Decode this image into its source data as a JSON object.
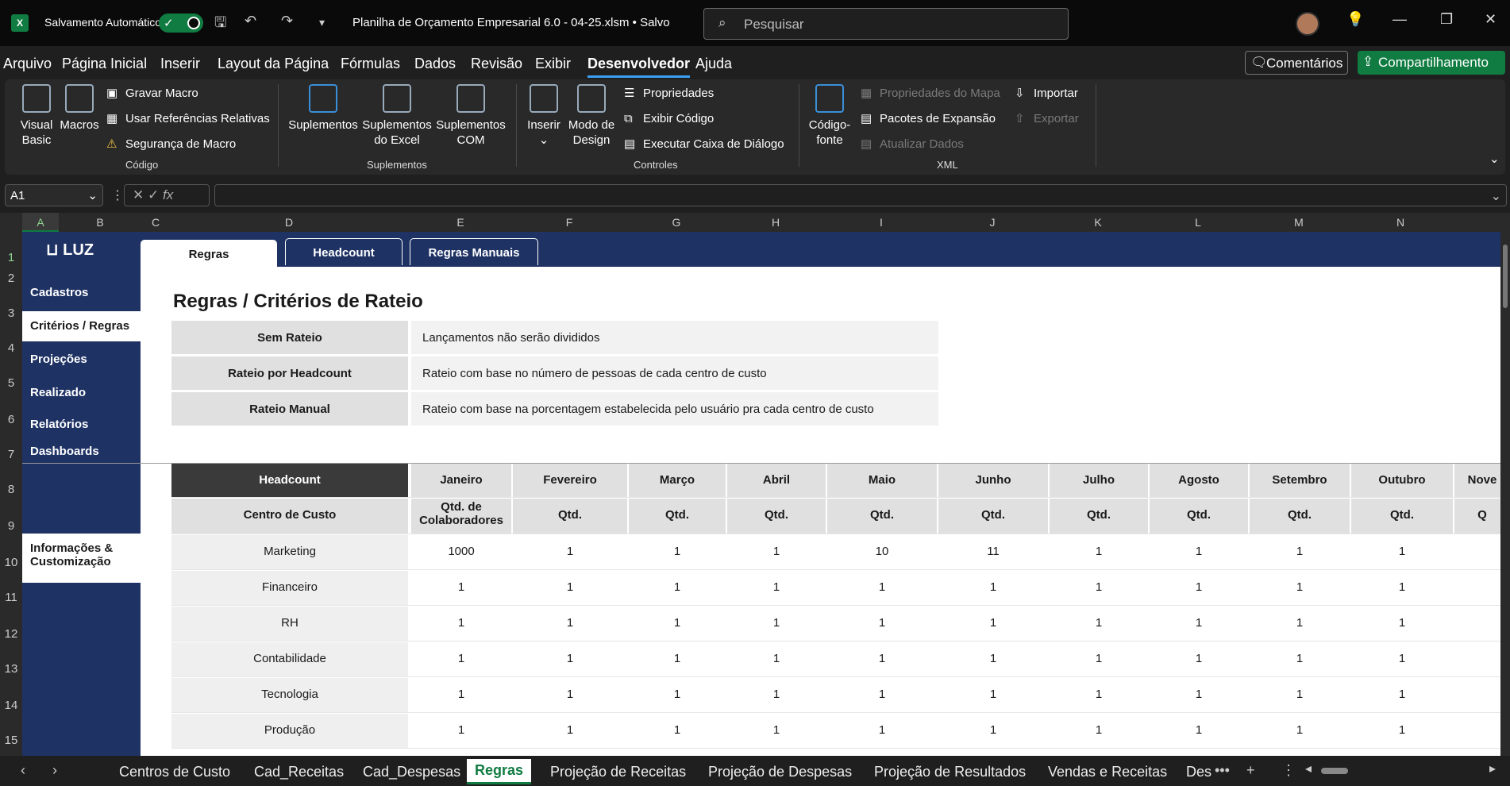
{
  "titlebar": {
    "autosave_label": "Salvamento Automático",
    "doc_title": "Planilha de Orçamento Empresarial 6.0 - 04-25.xlsm • Salvo",
    "search_placeholder": "Pesquisar"
  },
  "menu": [
    "Arquivo",
    "Página Inicial",
    "Inserir",
    "Layout da Página",
    "Fórmulas",
    "Dados",
    "Revisão",
    "Exibir",
    "Desenvolvedor",
    "Ajuda"
  ],
  "menu_active": "Desenvolvedor",
  "comments_label": "Comentários",
  "share_label": "Compartilhamento",
  "ribbon": {
    "codigo": {
      "label": "Código",
      "visual_basic": "Visual Basic",
      "macros": "Macros",
      "gravar": "Gravar Macro",
      "usar_ref": "Usar Referências Relativas",
      "seguranca": "Segurança de Macro"
    },
    "suplementos": {
      "label": "Suplementos",
      "sup": "Suplementos",
      "sup_excel": "Suplementos do Excel",
      "sup_com": "Suplementos COM"
    },
    "controles": {
      "label": "Controles",
      "inserir": "Inserir",
      "modo": "Modo de Design",
      "propriedades": "Propriedades",
      "exibir_codigo": "Exibir Código",
      "executar": "Executar Caixa de Diálogo"
    },
    "xml": {
      "label": "XML",
      "codigo_fonte": "Código-fonte",
      "prop_mapa": "Propriedades do Mapa",
      "pacotes": "Pacotes de Expansão",
      "atualizar": "Atualizar Dados",
      "importar": "Importar",
      "exportar": "Exportar"
    }
  },
  "namebox": "A1",
  "columns": [
    "A",
    "B",
    "C",
    "D",
    "E",
    "F",
    "G",
    "H",
    "I",
    "J",
    "K",
    "L",
    "M",
    "N"
  ],
  "rows": [
    "1",
    "2",
    "3",
    "4",
    "5",
    "6",
    "7",
    "8",
    "9",
    "10",
    "11",
    "12",
    "13",
    "14",
    "15"
  ],
  "logo": "LUZ",
  "sidebar": [
    "Cadastros",
    "Critérios / Regras",
    "Projeções",
    "Realizado",
    "Relatórios",
    "Dashboards",
    "Informações & Customização"
  ],
  "tabs": [
    "Regras",
    "Headcount",
    "Regras Manuais"
  ],
  "heading": "Regras / Critérios de Rateio",
  "rules": [
    {
      "label": "Sem Rateio",
      "desc": "Lançamentos não serão divididos"
    },
    {
      "label": "Rateio por Headcount",
      "desc": "Rateio com base no número de pessoas de cada centro de custo"
    },
    {
      "label": "Rateio Manual",
      "desc": "Rateio com base na porcentagem estabelecida pelo usuário pra cada centro de custo"
    }
  ],
  "headcount": {
    "title": "Headcount",
    "months": [
      "Janeiro",
      "Fevereiro",
      "Março",
      "Abril",
      "Maio",
      "Junho",
      "Julho",
      "Agosto",
      "Setembro",
      "Outubro",
      "Nove"
    ],
    "cc_label": "Centro de Custo",
    "sub_first": "Qtd. de Colaboradores",
    "sub": "Qtd.",
    "sub_last": "Q",
    "rows": [
      {
        "name": "Marketing",
        "values": [
          "1000",
          "1",
          "1",
          "1",
          "10",
          "11",
          "1",
          "1",
          "1",
          "1"
        ]
      },
      {
        "name": "Financeiro",
        "values": [
          "1",
          "1",
          "1",
          "1",
          "1",
          "1",
          "1",
          "1",
          "1",
          "1"
        ]
      },
      {
        "name": "RH",
        "values": [
          "1",
          "1",
          "1",
          "1",
          "1",
          "1",
          "1",
          "1",
          "1",
          "1"
        ]
      },
      {
        "name": "Contabilidade",
        "values": [
          "1",
          "1",
          "1",
          "1",
          "1",
          "1",
          "1",
          "1",
          "1",
          "1"
        ]
      },
      {
        "name": "Tecnologia",
        "values": [
          "1",
          "1",
          "1",
          "1",
          "1",
          "1",
          "1",
          "1",
          "1",
          "1"
        ]
      },
      {
        "name": "Produção",
        "values": [
          "1",
          "1",
          "1",
          "1",
          "1",
          "1",
          "1",
          "1",
          "1",
          "1"
        ]
      }
    ]
  },
  "sheet_tabs": [
    "Centros de Custo",
    "Cad_Receitas",
    "Cad_Despesas",
    "Regras",
    "Projeção de Receitas",
    "Projeção de Despesas",
    "Projeção de Resultados",
    "Vendas e Receitas",
    "Des"
  ],
  "sheet_active": "Regras"
}
